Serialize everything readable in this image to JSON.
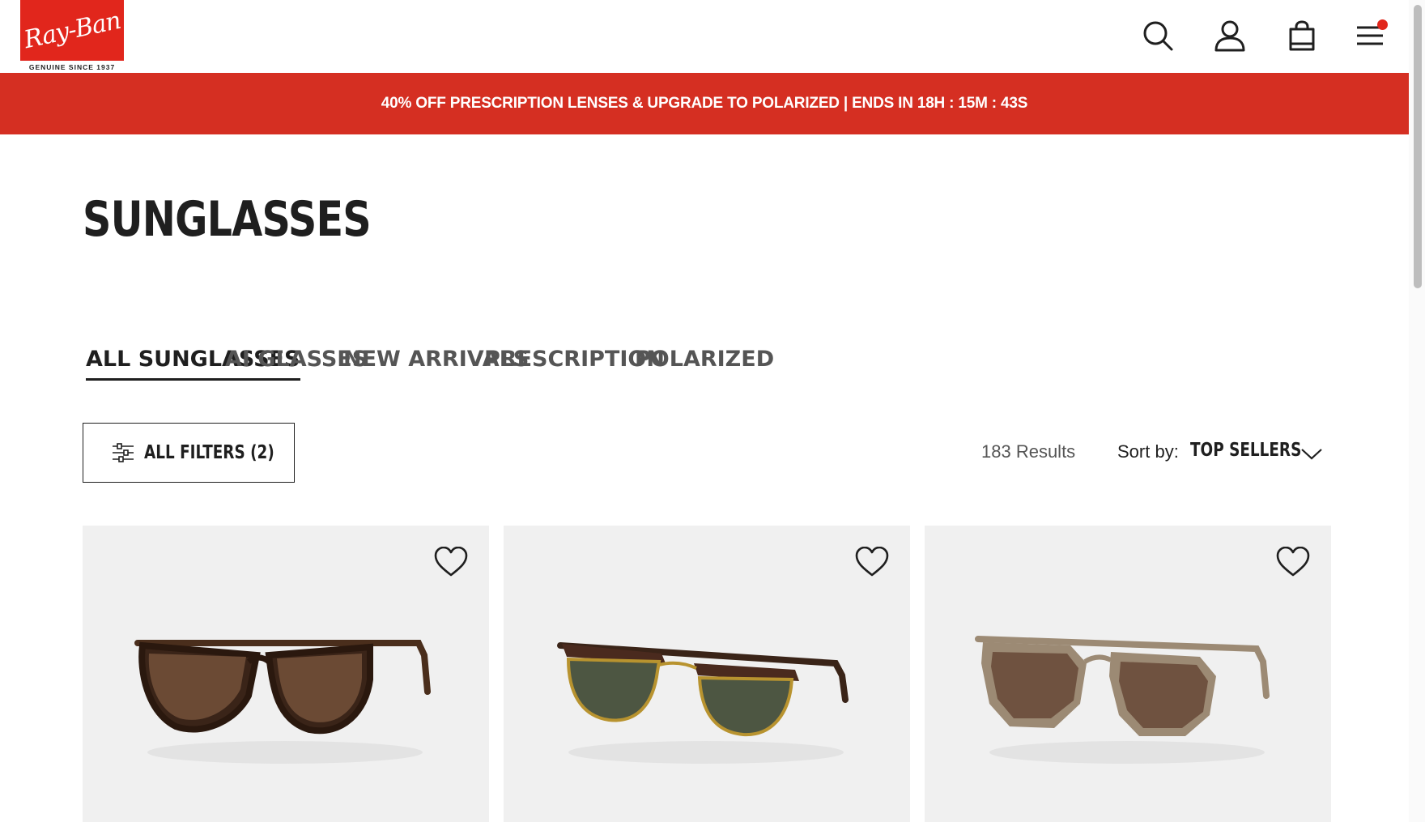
{
  "brand": {
    "logo_text": "Ray-Ban",
    "tagline": "GENUINE SINCE 1937",
    "color": "#e1261c"
  },
  "header": {
    "icons": [
      "search-icon",
      "account-icon",
      "bag-icon",
      "menu-icon"
    ]
  },
  "promo": {
    "text": "40% OFF PRESCRIPTION LENSES & UPGRADE TO POLARIZED | ENDS IN  18H : 15M : 43S",
    "color": "#d52f22"
  },
  "page": {
    "title": "SUNGLASSES"
  },
  "tabs": [
    {
      "label": "ALL SUNGLASSES",
      "active": true
    },
    {
      "label": "AI GLASSES",
      "active": false
    },
    {
      "label": "NEW ARRIVALS",
      "active": false
    },
    {
      "label": "PRESCRIPTION",
      "active": false
    },
    {
      "label": "POLARIZED",
      "active": false
    }
  ],
  "toolbar": {
    "filters_label": "ALL FILTERS (2)",
    "results": "183 Results",
    "sort_label": "Sort by:",
    "sort_value": "TOP SELLERS"
  },
  "products": [
    {
      "image": "tortoise-round-sunglasses",
      "lens": "brown-gradient"
    },
    {
      "image": "clubmaster-sunglasses",
      "lens": "green"
    },
    {
      "image": "beige-hexagonal-sunglasses",
      "lens": "brown-gradient"
    }
  ]
}
